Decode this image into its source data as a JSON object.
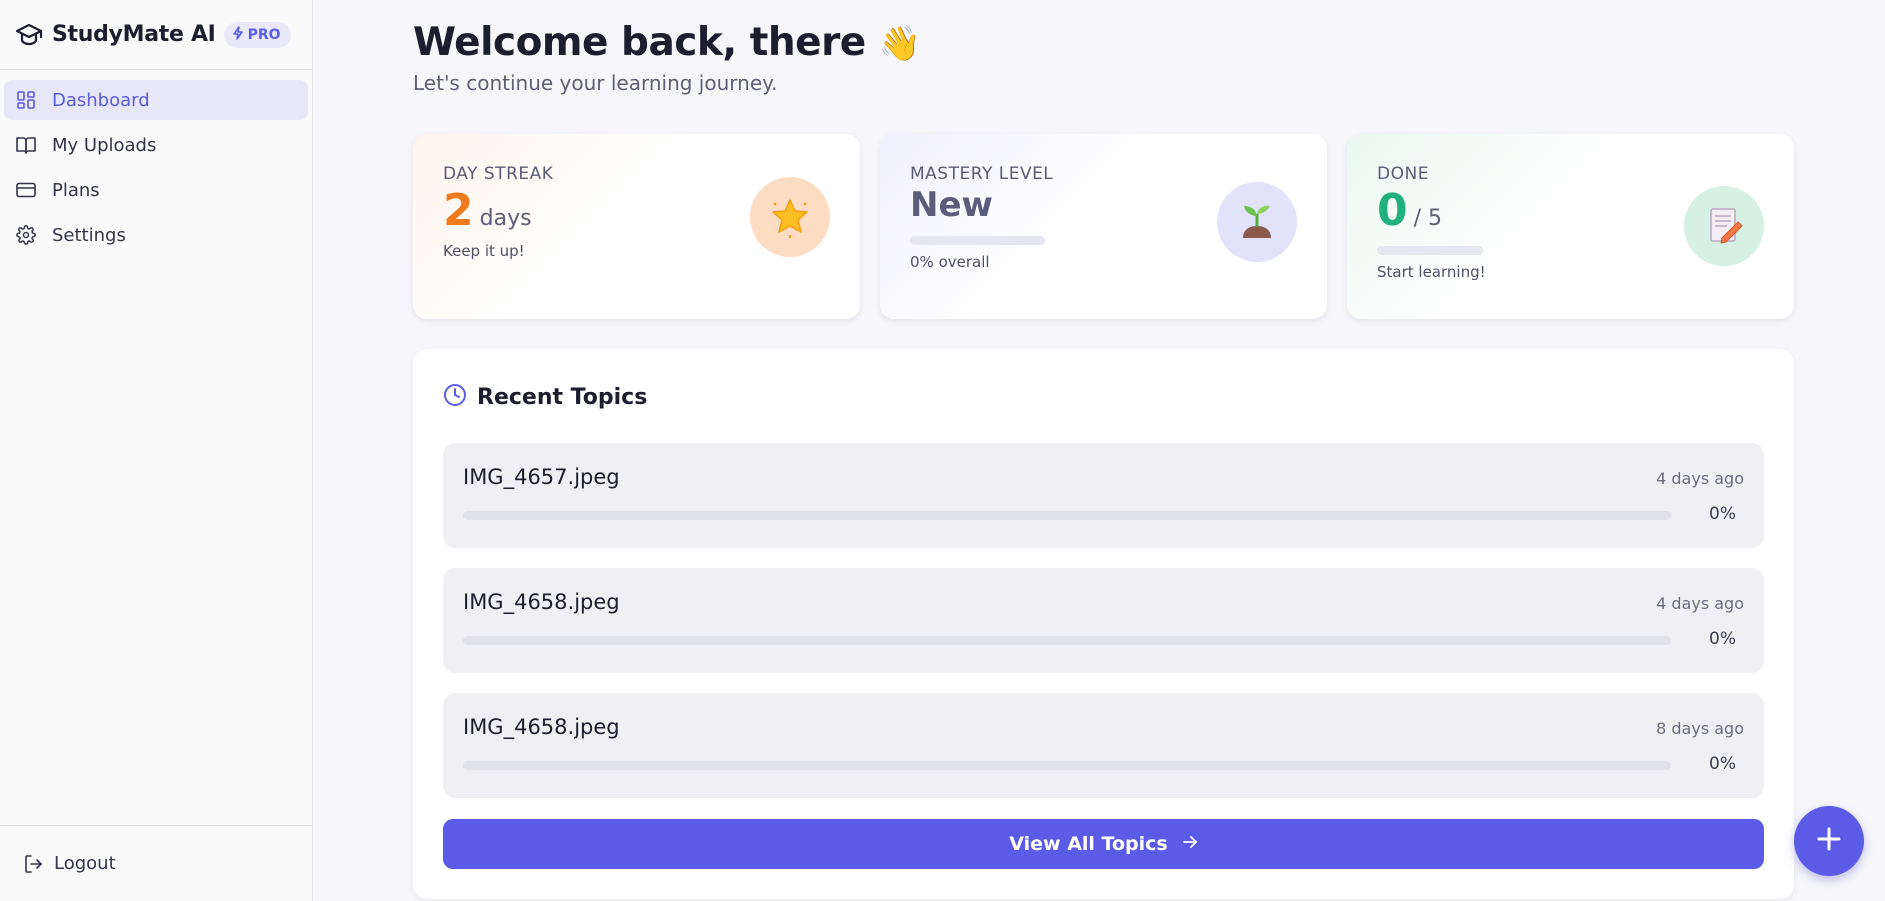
{
  "brand": {
    "name": "StudyMate AI",
    "badge": "PRO"
  },
  "sidebar": {
    "items": [
      {
        "label": "Dashboard",
        "icon": "grid-icon",
        "active": true
      },
      {
        "label": "My Uploads",
        "icon": "book-icon",
        "active": false
      },
      {
        "label": "Plans",
        "icon": "credit-card-icon",
        "active": false
      },
      {
        "label": "Settings",
        "icon": "gear-icon",
        "active": false
      }
    ],
    "logout_label": "Logout"
  },
  "welcome": {
    "title": "Welcome back, there",
    "emoji": "👋",
    "subtitle": "Let's continue your learning journey."
  },
  "stats": {
    "streak": {
      "label": "DAY STREAK",
      "value": "2",
      "unit": "days",
      "sub": "Keep it up!",
      "icon": "star-icon",
      "color": "#f07a1e"
    },
    "mastery": {
      "label": "MASTERY LEVEL",
      "value": "New",
      "sub": "0% overall",
      "progress": 0,
      "icon": "sprout-icon",
      "color": "#5a5c7a"
    },
    "done": {
      "label": "DONE",
      "value": "0",
      "unit": "/ 5",
      "sub": "Start learning!",
      "progress": 0,
      "icon": "memo-icon",
      "color": "#22b07d"
    }
  },
  "recent": {
    "title": "Recent Topics",
    "topics": [
      {
        "name": "IMG_4657.jpeg",
        "time": "4 days ago",
        "percent": "0%",
        "progress": 0
      },
      {
        "name": "IMG_4658.jpeg",
        "time": "4 days ago",
        "percent": "0%",
        "progress": 0
      },
      {
        "name": "IMG_4658.jpeg",
        "time": "8 days ago",
        "percent": "0%",
        "progress": 0
      }
    ],
    "view_all_label": "View All Topics"
  },
  "colors": {
    "accent": "#5b5be8",
    "accent_soft": "#e7e7f8"
  }
}
